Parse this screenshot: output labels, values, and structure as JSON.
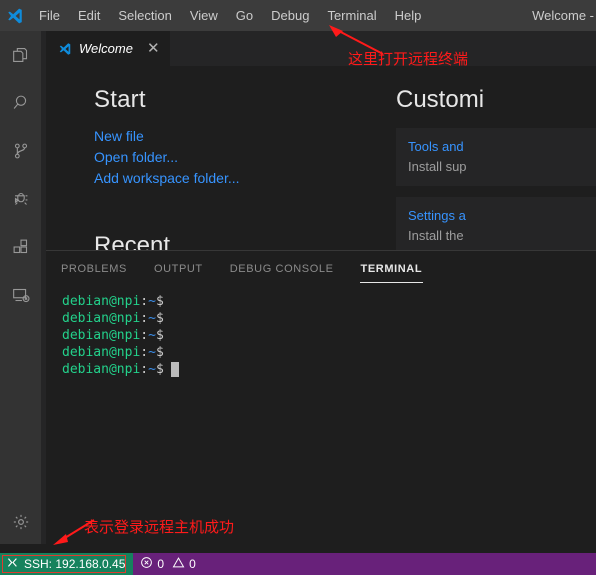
{
  "window": {
    "title": "Welcome -",
    "logo_icon": "vscode-logo-icon"
  },
  "menubar": {
    "items": [
      {
        "label": "File"
      },
      {
        "label": "Edit"
      },
      {
        "label": "Selection"
      },
      {
        "label": "View"
      },
      {
        "label": "Go"
      },
      {
        "label": "Debug"
      },
      {
        "label": "Terminal"
      },
      {
        "label": "Help"
      }
    ]
  },
  "activitybar": {
    "items": [
      {
        "icon": "files-explorer-icon",
        "title": "Explorer"
      },
      {
        "icon": "search-icon",
        "title": "Search"
      },
      {
        "icon": "source-control-branch-icon",
        "title": "Source Control"
      },
      {
        "icon": "debug-bug-icon",
        "title": "Run and Debug"
      },
      {
        "icon": "extensions-blocks-icon",
        "title": "Extensions"
      },
      {
        "icon": "remote-explorer-monitor-icon",
        "title": "Remote Explorer"
      }
    ],
    "bottom": [
      {
        "icon": "gear-icon",
        "title": "Manage"
      }
    ]
  },
  "editor": {
    "tabs": [
      {
        "label": "Welcome",
        "icon": "vscode-logo-icon",
        "close_icon": "close-icon",
        "active": true
      }
    ]
  },
  "welcome": {
    "start": {
      "heading": "Start",
      "links": [
        {
          "label": "New file"
        },
        {
          "label": "Open folder..."
        },
        {
          "label": "Add workspace folder..."
        }
      ]
    },
    "recent": {
      "heading": "Recent"
    },
    "customize": {
      "heading": "Customi",
      "cards": [
        {
          "title": "Tools and",
          "desc": "Install sup"
        },
        {
          "title": "Settings a",
          "desc": "Install the"
        }
      ]
    }
  },
  "panel": {
    "tabs": [
      {
        "label": "PROBLEMS",
        "active": false
      },
      {
        "label": "OUTPUT",
        "active": false
      },
      {
        "label": "DEBUG CONSOLE",
        "active": false
      },
      {
        "label": "TERMINAL",
        "active": true
      }
    ],
    "terminal": {
      "prompt": {
        "user_host": "debian@npi",
        "colon": ":",
        "path": "~",
        "sigil": "$"
      },
      "line_count": 5,
      "lines": [
        {
          "user_host": "debian@npi",
          "colon": ":",
          "path": "~",
          "sigil": "$",
          "cursor": false
        },
        {
          "user_host": "debian@npi",
          "colon": ":",
          "path": "~",
          "sigil": "$",
          "cursor": false
        },
        {
          "user_host": "debian@npi",
          "colon": ":",
          "path": "~",
          "sigil": "$",
          "cursor": false
        },
        {
          "user_host": "debian@npi",
          "colon": ":",
          "path": "~",
          "sigil": "$",
          "cursor": false
        },
        {
          "user_host": "debian@npi",
          "colon": ":",
          "path": "~",
          "sigil": "$",
          "cursor": true
        }
      ]
    }
  },
  "statusbar": {
    "remote": {
      "icon": "remote-ssh-icon",
      "label": "SSH: 192.168.0.45",
      "background": "#16825d",
      "highlight_color": "#e03a2f"
    },
    "problems": {
      "error_icon": "error-circle-icon",
      "error_count": "0",
      "warning_icon": "warning-triangle-icon",
      "warning_count": "0"
    },
    "background": "#68217a"
  },
  "annotations": {
    "color": "#ff1a1a",
    "items": [
      {
        "text": "这里打开远程终端",
        "arrow": "arrow-up-left"
      },
      {
        "text": "表示登录远程主机成功",
        "arrow": "arrow-down-left"
      }
    ]
  }
}
